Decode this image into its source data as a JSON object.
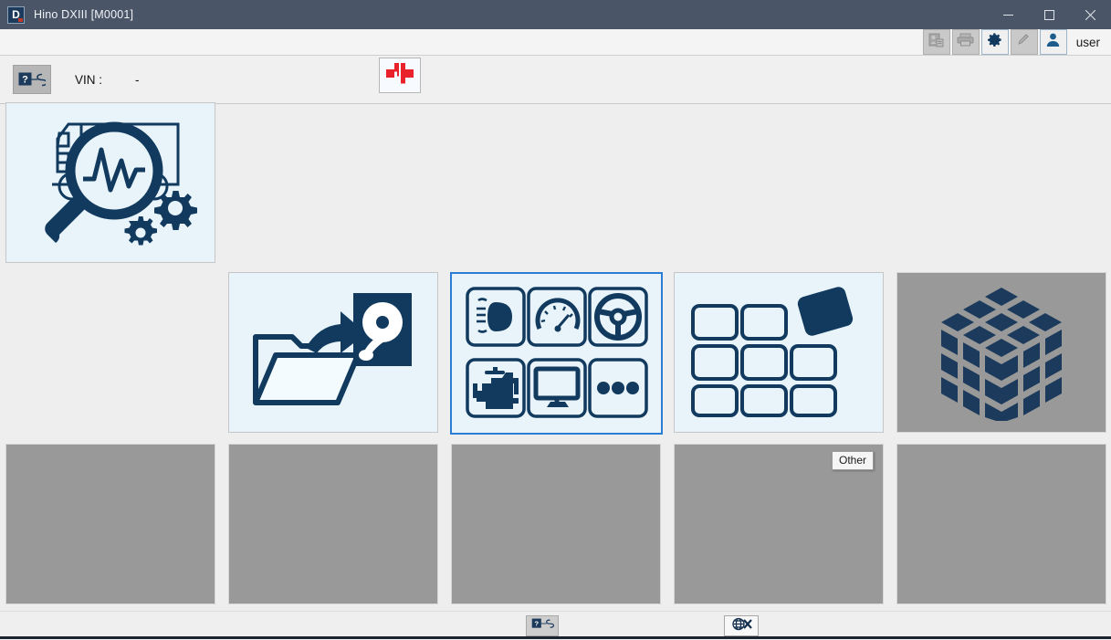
{
  "window": {
    "title": "Hino DXIII [M0001]",
    "app_icon_letter": "D",
    "controls": [
      {
        "name": "minimize-button",
        "glyph": "minimize"
      },
      {
        "name": "maximize-button",
        "glyph": "maximize"
      },
      {
        "name": "close-button",
        "glyph": "close"
      }
    ],
    "titlebar_color": "#4a5568"
  },
  "toolbar": {
    "buttons": [
      {
        "name": "report-button",
        "icon": "report-icon",
        "enabled": false
      },
      {
        "name": "print-button",
        "icon": "printer-icon",
        "enabled": false
      },
      {
        "name": "settings-button",
        "icon": "gear-icon",
        "enabled": true
      },
      {
        "name": "edit-button",
        "icon": "pencil-icon",
        "enabled": false
      },
      {
        "name": "user-button",
        "icon": "user-icon",
        "enabled": true
      }
    ],
    "user_label": "user"
  },
  "vin_bar": {
    "support_icon": "help-support-icon",
    "label": "VIN :",
    "value": "-",
    "connection_icon": "disconnected-plug-icon",
    "connection_color": "#e8212b"
  },
  "tiles": {
    "diagnostics": {
      "name": "tile-vehicle-diagnostics",
      "icon": "truck-magnifier-gears-icon",
      "enabled": true
    },
    "row2": [
      {
        "name": "tile-save-to-disk",
        "icon": "folder-arrow-harddisk-icon",
        "enabled": true,
        "selected": false
      },
      {
        "name": "tile-vehicle-functions",
        "icon": "six-function-grid-icon",
        "enabled": true,
        "selected": true
      },
      {
        "name": "tile-customize-grid",
        "icon": "tile-grid-popout-icon",
        "enabled": true,
        "selected": false
      },
      {
        "name": "tile-cube",
        "icon": "cube-blocks-icon",
        "enabled": false,
        "selected": false
      }
    ],
    "row3": [
      {
        "name": "tile-empty-1",
        "enabled": false
      },
      {
        "name": "tile-empty-2",
        "enabled": false
      },
      {
        "name": "tile-empty-3",
        "enabled": false
      },
      {
        "name": "tile-empty-4",
        "enabled": false
      },
      {
        "name": "tile-empty-5",
        "enabled": false
      }
    ],
    "disabled_color": "#999999",
    "tile_bg": "#e8f4fa",
    "selected_border_color": "#2a7fd4"
  },
  "tooltip": {
    "text": "Other"
  },
  "status_bar": {
    "buttons": [
      {
        "name": "support-status-button",
        "icon": "help-support-icon"
      },
      {
        "name": "network-offline-button",
        "icon": "globe-offline-icon"
      }
    ]
  },
  "colors": {
    "accent_blue": "#113a5e",
    "selection_blue": "#2a7fd4",
    "red": "#e8212b",
    "page_bg": "#eeeeee"
  }
}
